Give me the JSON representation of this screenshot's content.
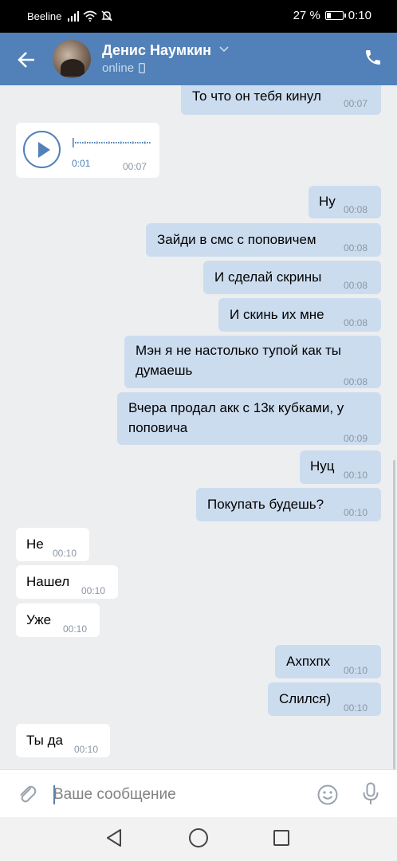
{
  "status_bar": {
    "carrier": "Beeline",
    "battery": "27 %",
    "battery_level": 0.27,
    "time": "0:10"
  },
  "header": {
    "name": "Денис Наумкин",
    "status": "online"
  },
  "voice_message": {
    "duration": "0:01",
    "time": "00:07"
  },
  "messages": [
    {
      "text": "То что он тебя кинул",
      "time": "00:07",
      "side": "out"
    },
    {
      "text": "Ну",
      "time": "00:08",
      "side": "out"
    },
    {
      "text": "Зайди в смс с поповичем",
      "time": "00:08",
      "side": "out"
    },
    {
      "text": "И сделай скрины",
      "time": "00:08",
      "side": "out"
    },
    {
      "text": "И скинь их мне",
      "time": "00:08",
      "side": "out"
    },
    {
      "text": "Мэн я не настолько тупой как ты думаешь",
      "time": "00:08",
      "side": "out"
    },
    {
      "text": "Вчера продал акк с 13к кубками, у поповича",
      "time": "00:09",
      "side": "out"
    },
    {
      "text": "Нуц",
      "time": "00:10",
      "side": "out"
    },
    {
      "text": "Покупать будешь?",
      "time": "00:10",
      "side": "out"
    },
    {
      "text": "Не",
      "time": "00:10",
      "side": "in"
    },
    {
      "text": "Нашел",
      "time": "00:10",
      "side": "in"
    },
    {
      "text": "Уже",
      "time": "00:10",
      "side": "in"
    },
    {
      "text": "Ахпхпх",
      "time": "00:10",
      "side": "out"
    },
    {
      "text": "Слился)",
      "time": "00:10",
      "side": "out"
    },
    {
      "text": "Ты да",
      "time": "00:10",
      "side": "in"
    }
  ],
  "input": {
    "placeholder": "Ваше сообщение"
  },
  "colors": {
    "header": "#5181b8",
    "outgoing_bubble": "#ccdcef",
    "incoming_bubble": "#ffffff",
    "background": "#edeef0"
  },
  "icons": {
    "back": "arrow-left-icon",
    "phone": "phone-icon",
    "attach": "paperclip-icon",
    "emoji": "smiley-icon",
    "mic": "microphone-icon"
  }
}
